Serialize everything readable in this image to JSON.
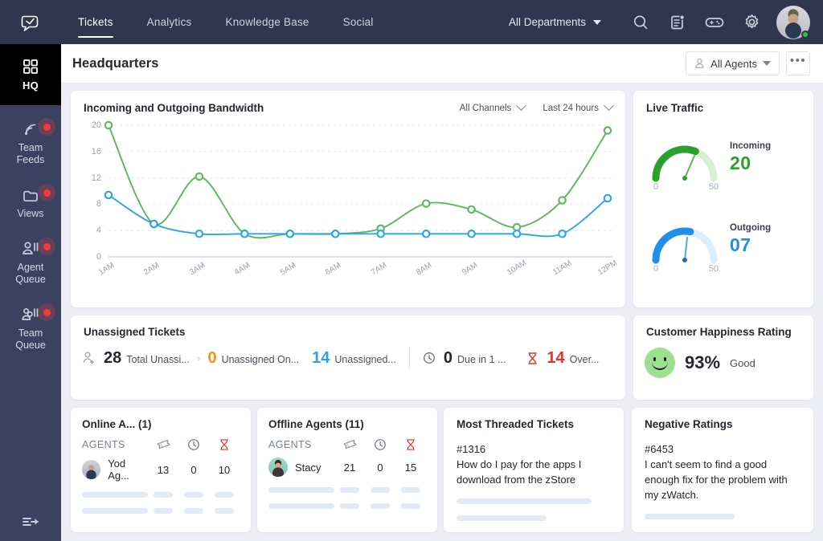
{
  "topbar": {
    "logo_icon": "zoho-desk-logo-icon",
    "nav": [
      {
        "label": "Tickets",
        "active": true
      },
      {
        "label": "Analytics",
        "active": false
      },
      {
        "label": "Knowledge Base",
        "active": false
      },
      {
        "label": "Social",
        "active": false
      }
    ],
    "department_select": "All Departments",
    "icons": [
      "search-icon",
      "notes-icon",
      "gamification-icon",
      "gear-icon"
    ],
    "avatar": "user-avatar",
    "status": "online"
  },
  "sidebar": {
    "hq": {
      "label": "HQ",
      "icon": "grid-icon"
    },
    "items": [
      {
        "label": "Team\nFeeds",
        "icon": "feed-icon",
        "badge": true
      },
      {
        "label": "Views",
        "icon": "folder-icon",
        "badge": true
      },
      {
        "label": "Agent\nQueue",
        "icon": "agent-queue-icon",
        "badge": true
      },
      {
        "label": "Team\nQueue",
        "icon": "team-queue-icon",
        "badge": true
      }
    ],
    "collapse": "collapse-sidebar-icon"
  },
  "page_header": {
    "title": "Headquarters",
    "agents_filter": "All Agents",
    "more": "•••"
  },
  "bandwidth": {
    "title": "Incoming and Outgoing Bandwidth",
    "channel_filter": "All Channels",
    "range_filter": "Last 24 hours"
  },
  "chart_data": {
    "type": "line",
    "title": "Incoming and Outgoing Bandwidth",
    "xlabel": "",
    "ylabel": "",
    "ylim": [
      0,
      20
    ],
    "yticks": [
      0,
      4,
      8,
      12,
      16,
      20
    ],
    "grid": true,
    "legend": "none",
    "categories": [
      "1AM",
      "2AM",
      "3AM",
      "4AM",
      "5AM",
      "6AM",
      "7AM",
      "8AM",
      "9AM",
      "10AM",
      "11AM",
      "12PM"
    ],
    "series": [
      {
        "name": "Incoming",
        "color": "#5cb85c",
        "values": [
          20,
          5,
          12.2,
          3.5,
          3.5,
          3.5,
          4.3,
          8.1,
          7.2,
          4.5,
          8.6,
          19.2
        ]
      },
      {
        "name": "Outgoing",
        "color": "#2aa3e8",
        "values": [
          9.4,
          5,
          3.5,
          3.5,
          3.5,
          3.5,
          3.5,
          3.5,
          3.5,
          3.5,
          3.5,
          8.9
        ]
      }
    ]
  },
  "live_traffic": {
    "title": "Live Traffic",
    "gauges": [
      {
        "caption": "Incoming",
        "value": "20",
        "max_label": "50",
        "min_label": "0",
        "color": "#2ca02c",
        "percent": 0.62
      },
      {
        "caption": "Outgoing",
        "value": "07",
        "max_label": "50",
        "min_label": "0",
        "color": "#1f8fe8",
        "percent": 0.56
      }
    ]
  },
  "unassigned": {
    "title": "Unassigned Tickets",
    "stats": [
      {
        "icon": "add-user-icon",
        "value": "28",
        "label": "Total Unassi...",
        "color": "#23272f"
      },
      {
        "icon": "",
        "value": "0",
        "label": "Unassigned On...",
        "color": "#f59211"
      },
      {
        "icon": "",
        "value": "14",
        "label": "Unassigned...",
        "color": "#2aa3e8"
      },
      {
        "icon": "clock-icon",
        "value": "0",
        "label": "Due in 1 ...",
        "color": "#23272f"
      },
      {
        "icon": "hourglass-icon",
        "value": "14",
        "label": "Over...",
        "color": "#e8332a"
      }
    ]
  },
  "happiness": {
    "title": "Customer Happiness Rating",
    "icon": "happy-face-icon",
    "percent": "93%",
    "word": "Good"
  },
  "online_agents": {
    "title": "Online A... (1)",
    "col_agents": "AGENTS",
    "col_icons": [
      "ticket-icon",
      "clock-icon",
      "hourglass-icon"
    ],
    "rows": [
      {
        "avatar": "agent-avatar-yod",
        "name": "Yod Ag...",
        "tickets": "13",
        "due": "0",
        "overdue": "10"
      }
    ],
    "placeholder_rows": 2
  },
  "offline_agents": {
    "title": "Offline Agents (11)",
    "col_agents": "AGENTS",
    "col_icons": [
      "ticket-icon",
      "clock-icon",
      "hourglass-icon"
    ],
    "rows": [
      {
        "avatar": "agent-avatar-stacy",
        "name": "Stacy",
        "tickets": "21",
        "due": "0",
        "overdue": "15"
      }
    ],
    "placeholder_rows": 2
  },
  "threaded": {
    "title": "Most Threaded Tickets",
    "ticket_id": "#1316",
    "ticket_text": "How do I pay for the apps I download from the zStore",
    "placeholder_rows": 2
  },
  "negative": {
    "title": "Negative Ratings",
    "ticket_id": "#6453",
    "ticket_text": "I can't seem to find a good enough fix for the problem with my zWatch.",
    "placeholder_rows": 1
  }
}
